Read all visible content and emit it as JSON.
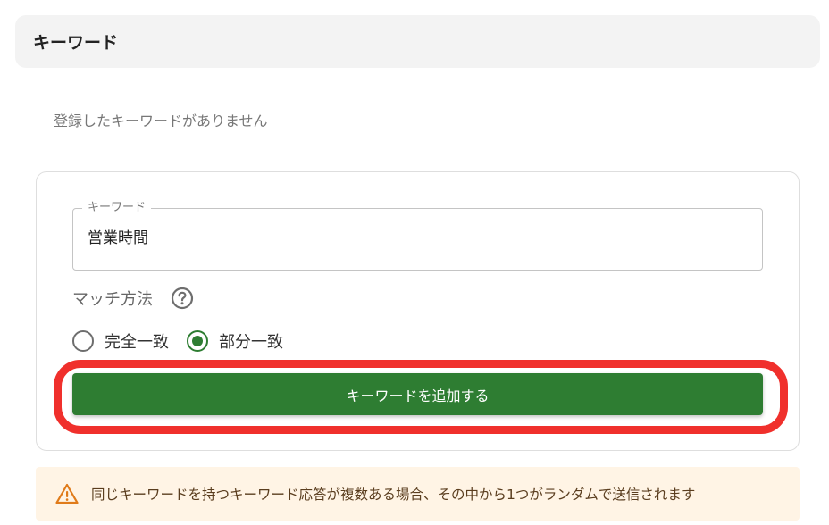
{
  "header": {
    "title": "キーワード"
  },
  "empty_message": "登録したキーワードがありません",
  "form": {
    "keyword_field": {
      "legend": "キーワード",
      "value": "営業時間"
    },
    "match_method": {
      "label": "マッチ方法",
      "help_icon": "question-circle-icon",
      "options": [
        {
          "label": "完全一致",
          "checked": false
        },
        {
          "label": "部分一致",
          "checked": true
        }
      ]
    },
    "add_button_label": "キーワードを追加する"
  },
  "notice": {
    "icon": "warning-triangle-icon",
    "text": "同じキーワードを持つキーワード応答が複数ある場合、その中から1つがランダムで送信されます"
  },
  "colors": {
    "accent_green": "#2e7d32",
    "highlight_red": "#f0302c",
    "notice_bg": "#fff4e5",
    "warning_orange": "#e07b1a"
  }
}
